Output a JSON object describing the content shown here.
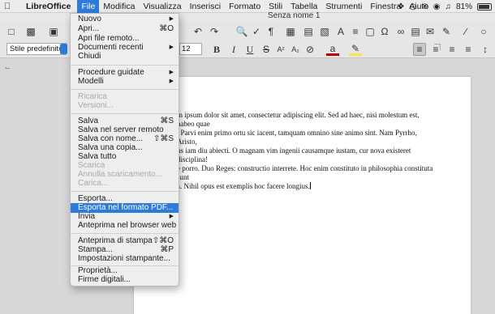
{
  "menubar": {
    "apple": "",
    "app_name": "LibreOffice",
    "items": [
      "File",
      "Modifica",
      "Visualizza",
      "Inserisci",
      "Formato",
      "Stili",
      "Tabella",
      "Strumenti",
      "Finestra",
      "Aiuto"
    ],
    "battery": "81%"
  },
  "window": {
    "title": "Senza nome 1"
  },
  "formatting": {
    "paragraph_style": "Stile predefinito",
    "font_size": "12"
  },
  "document": {
    "text": "m ipsum dolor sit amet, consectetur adipiscing elit. Sed ad haec, nisi molestum est, habeo quae\n. Parvi enim primo ortu sic iacent, tamquam omnino sine animo sint. Nam Pyrrho, Aristo,\nus iam diu abiecti. O magnam vim ingenii causamque iustam, cur nova existeret disciplina!\ne porro. Duo Reges: constructio interrete. Hoc enim constituto in philosophia constituta sunt\na. Nihil opus est exemplis hoc facere longius."
  },
  "file_menu": {
    "nuovo": "Nuovo",
    "apri": "Apri...",
    "apri_sc": "⌘O",
    "apri_remoto": "Apri file remoto...",
    "recenti": "Documenti recenti",
    "chiudi": "Chiudi",
    "procedure": "Procedure guidate",
    "modelli": "Modelli",
    "ricarica": "Ricarica",
    "versioni": "Versioni...",
    "salva": "Salva",
    "salva_sc": "⌘S",
    "salva_server": "Salva nel server remoto",
    "salva_nome": "Salva con nome...",
    "salva_nome_sc": "⇧⌘S",
    "salva_copia": "Salva una copia...",
    "salva_tutto": "Salva tutto",
    "scarica": "Scarica",
    "annulla": "Annulla scaricamento...",
    "carica": "Carica...",
    "esporta": "Esporta...",
    "esporta_pdf": "Esporta nel formato PDF...",
    "invia": "Invia",
    "anteprima_browser": "Anteprima nel browser web",
    "anteprima_stampa": "Anteprima di stampa",
    "anteprima_stampa_sc": "⇧⌘O",
    "stampa": "Stampa...",
    "stampa_sc": "⌘P",
    "impostazioni": "Impostazioni stampante...",
    "proprieta": "Proprietà...",
    "firme": "Firme digitali..."
  },
  "colors": {
    "accent": "#2f7bd9",
    "font_color": "#c00000",
    "highlight": "#ffe14d"
  }
}
